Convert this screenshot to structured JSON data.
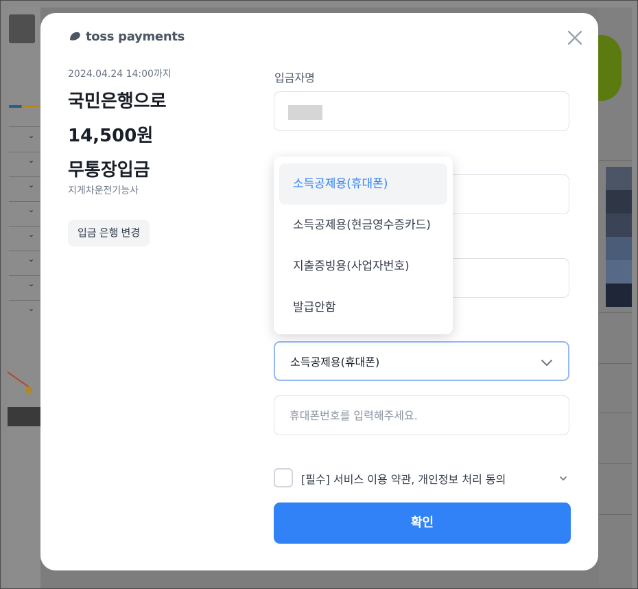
{
  "logo": {
    "text": "toss payments",
    "icon": "toss-logo-icon"
  },
  "deposit": {
    "deadline": "2024.04.24 14:00까지",
    "title_lines": [
      "국민은행으로",
      "14,500원",
      "무통장입금"
    ],
    "account_holder": "지게차운전기능사",
    "change_bank_label": "입금 은행 변경"
  },
  "form": {
    "depositor_label": "입금자명",
    "receipt_selected": "소득공제용(휴대폰)",
    "phone_placeholder": "휴대폰번호를 입력해주세요."
  },
  "dropdown": {
    "options": [
      "소득공제용(휴대폰)",
      "소득공제용(현금영수증카드)",
      "지출증빙용(사업자번호)",
      "발급안함"
    ],
    "selected_index": 0
  },
  "agreement": {
    "label": "[필수] 서비스 이용 약관, 개인정보 처리 동의",
    "checked": false
  },
  "confirm_label": "확인",
  "colors": {
    "primary": "#3182f6",
    "text_dark": "#191f28",
    "text_gray": "#6b7684"
  }
}
